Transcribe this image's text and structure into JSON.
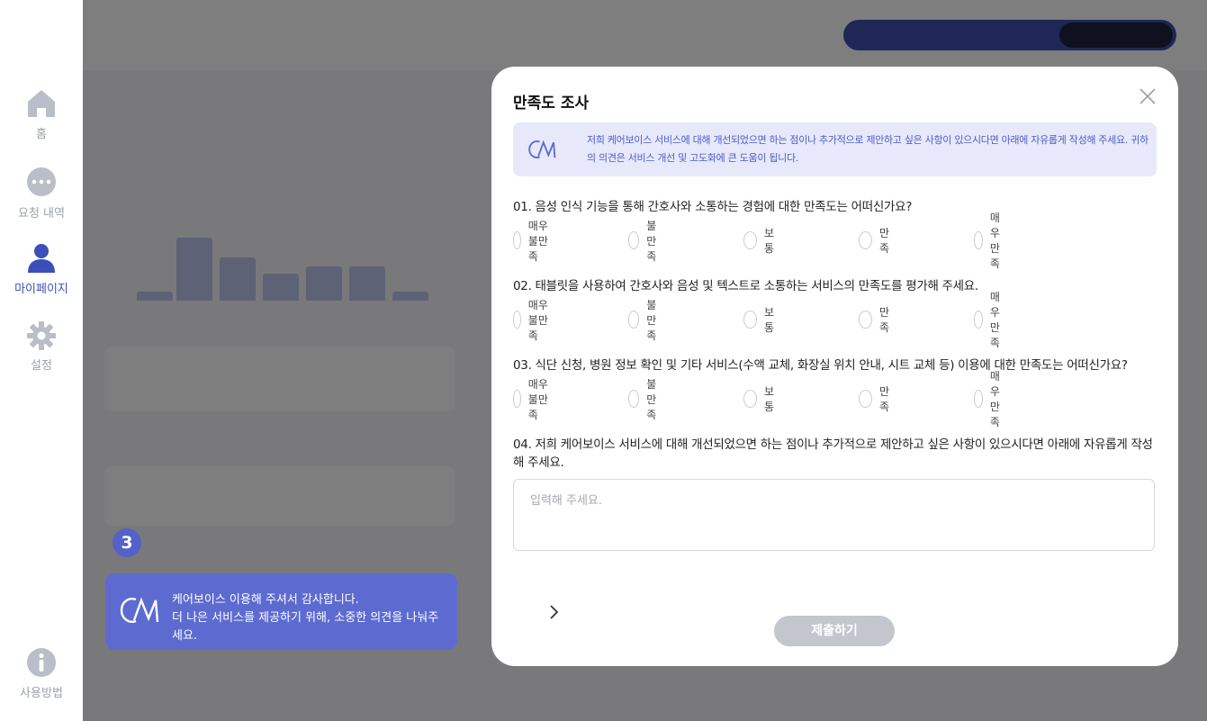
{
  "sidebar": {
    "items": [
      {
        "label": "홈",
        "icon": "home-icon"
      },
      {
        "label": "요청 내역",
        "icon": "chat-bubble-icon"
      },
      {
        "label": "마이페이지",
        "icon": "user-icon"
      },
      {
        "label": "설정",
        "icon": "gear-icon"
      },
      {
        "label": "사용방법",
        "icon": "info-icon"
      }
    ]
  },
  "tooltip": {
    "step": "3",
    "line1": "케어보이스 이용해 주셔서 감사합니다.",
    "line2": "더 나은 서비스를 제공하기 위해, 소중한 의견을 나눠주세요."
  },
  "modal": {
    "title": "만족도 조사",
    "notice": "저희 케어보이스 서비스에 대해 개선되었으면 하는 점이나 추가적으로 제안하고 싶은 사항이 있으시다면 아래에 자유롭게 작성해 주세요. 귀하의 의견은 서비스 개선 및 고도화에 큰 도움이 됩니다.",
    "questions": [
      "01. 음성 인식 기능을 통해 간호사와 소통하는 경험에 대한 만족도는 어떠신가요?",
      "02. 태블릿을 사용하여 간호사와 음성 및 텍스트로 소통하는 서비스의 만족도를 평가해 주세요.",
      "03. 식단 신청, 병원 정보 확인 및 기타 서비스(수액 교체, 화장실 위치 안내, 시트 교체 등) 이용에 대한 만족도는 어떠신가요?",
      "04. 저희 케어보이스 서비스에 대해 개선되었으면 하는 점이나 추가적으로 제안하고 싶은 사항이 있으시다면 아래에 자유롭게 작성해 주세요."
    ],
    "options": [
      "매우 불만족",
      "불만족",
      "보통",
      "만족",
      "매우 만족"
    ],
    "textarea_placeholder": "입력해 주세요.",
    "submit_label": "제출하기"
  },
  "colors": {
    "accent": "#5d6bd1",
    "notice_bg": "#e7e9fb",
    "notice_text": "#4e5bc7",
    "submit_disabled": "#c4c6cd",
    "sidebar_active": "#3b4fb8"
  }
}
